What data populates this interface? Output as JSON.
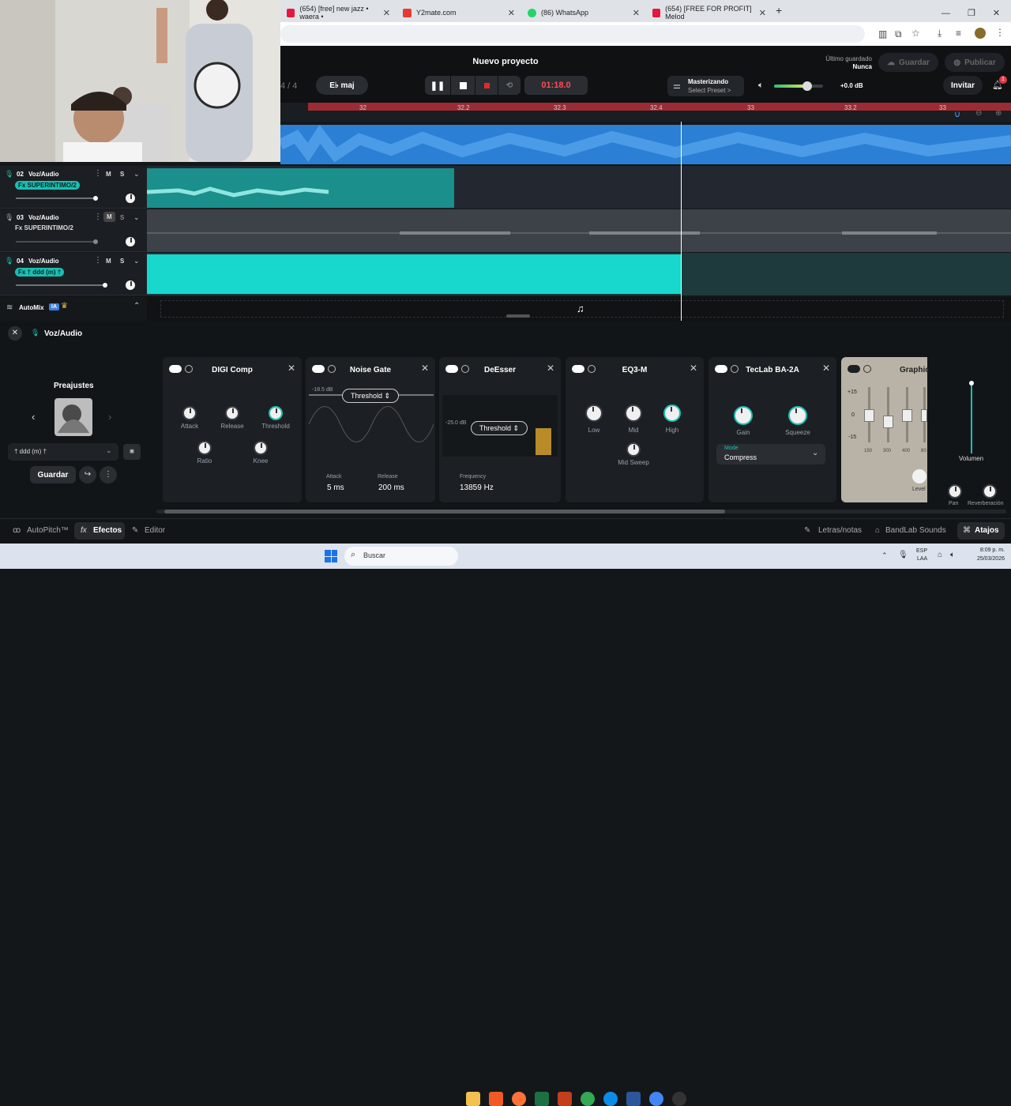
{
  "browser": {
    "tabs": [
      {
        "title": "(654) [free] new jazz • waera •",
        "color": "#e5173f"
      },
      {
        "title": "Y2mate.com",
        "color": "#e53935"
      },
      {
        "title": "(86) WhatsApp",
        "color": "#25d366"
      },
      {
        "title": "(654) [FREE FOR PROFIT] Melod",
        "color": "#e5173f"
      }
    ],
    "new_tab": "+"
  },
  "daw": {
    "project_title": "Nuevo proyecto",
    "time_sig": "4 / 4",
    "key": "E♭ maj",
    "time": "01:18.0",
    "mastering_label": "Masterizando",
    "mastering_preset": "Select Preset >",
    "master_volume": "+0.0 dB",
    "last_saved_label": "Último guardado",
    "last_saved_value": "Nunca",
    "save_btn": "Guardar",
    "publish_btn": "Publicar",
    "invite_btn": "Invitar",
    "notif_count": "1",
    "ruler_ticks": [
      "32",
      "32.2",
      "32.3",
      "32.4",
      "33",
      "33.2",
      "33"
    ],
    "tracks": [
      {
        "id": "02",
        "name": "Voz/Audio",
        "fx": "Fx SUPERINTIMO/2",
        "fx_active": true
      },
      {
        "id": "03",
        "name": "Voz/Audio",
        "fx": "Fx SUPERINTIMO/2",
        "fx_active": false
      },
      {
        "id": "04",
        "name": "Voz/Audio",
        "fx": "Fx † ddd (m) †",
        "fx_active": true
      }
    ],
    "mute": "M",
    "solo": "S",
    "automix": "AutoMix",
    "ia": "IA"
  },
  "fx": {
    "track_name": "Voz/Audio",
    "presets_title": "Preajustes",
    "preset_name": "† ddd (m) †",
    "save_btn": "Guardar",
    "cards": {
      "digi": {
        "title": "DIGI Comp",
        "knobs": [
          "Attack",
          "Release",
          "Threshold",
          "Ratio",
          "Knee"
        ]
      },
      "gate": {
        "title": "Noise Gate",
        "level": "-18.5 dB",
        "threshold": "Threshold",
        "attack_label": "Attack",
        "attack": "5 ms",
        "release_label": "Release",
        "release": "200 ms"
      },
      "deesser": {
        "title": "DeEsser",
        "level": "-25.0 dB",
        "threshold": "Threshold",
        "freq_label": "Frequency",
        "freq": "13859 Hz"
      },
      "eq": {
        "title": "EQ3-M",
        "knobs": [
          "Low",
          "Mid",
          "High",
          "Mid Sweep"
        ]
      },
      "teclab": {
        "title": "TecLab BA-2A",
        "knobs": [
          "Gain",
          "Squeeze"
        ],
        "mode_label": "Mode",
        "mode": "Compress"
      },
      "graphic": {
        "title": "Graphic",
        "scale": [
          "+15",
          "0",
          "-15"
        ],
        "bands": [
          "150",
          "300",
          "400",
          "80"
        ],
        "level": "Level"
      }
    },
    "volume_label": "Volumen",
    "pan_label": "Pan",
    "reverb_label": "Reverberación"
  },
  "footer": {
    "autopitch": "AutoPitch™",
    "effects": "Efectos",
    "editor": "Editor",
    "lyrics": "Letras/notas",
    "sounds": "BandLab Sounds",
    "shortcuts": "Atajos"
  },
  "taskbar": {
    "search": "Buscar",
    "lang": "ESP",
    "lang2": "LAA",
    "time": "8:09 p. m.",
    "date": "25/03/2026"
  }
}
